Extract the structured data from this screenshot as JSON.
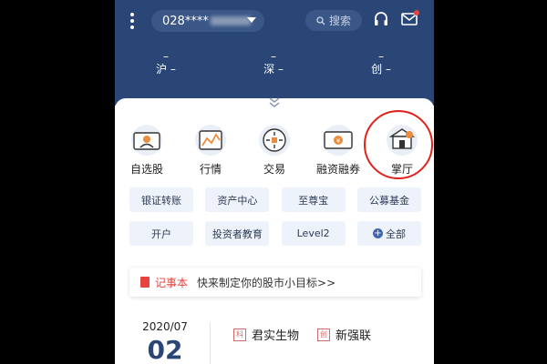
{
  "header": {
    "account": "028****",
    "search_label": "搜索",
    "indices": [
      {
        "name": "沪 –",
        "value": "–"
      },
      {
        "name": "深 –",
        "value": "–"
      },
      {
        "name": "创 –",
        "value": "–"
      }
    ]
  },
  "main_grid": [
    {
      "label": "自选股",
      "icon": "watchlist-icon"
    },
    {
      "label": "行情",
      "icon": "market-icon"
    },
    {
      "label": "交易",
      "icon": "trade-icon"
    },
    {
      "label": "融资融券",
      "icon": "margin-icon"
    },
    {
      "label": "掌厅",
      "icon": "hall-icon"
    }
  ],
  "chips_row1": [
    "银证转账",
    "资产中心",
    "至尊宝",
    "公募基金"
  ],
  "chips_row2": [
    "开户",
    "投资者教育",
    "Level2",
    "全部"
  ],
  "notebook": {
    "tag": "记事本",
    "text": "快来制定你的股市小目标>>"
  },
  "calendar": {
    "year_month": "2020/07",
    "day": "02"
  },
  "stocks": [
    {
      "tag": "科",
      "name": "君实生物"
    },
    {
      "tag": "创",
      "name": "新强联"
    }
  ],
  "colors": {
    "header": "#2a4677",
    "accent_red": "#e0211c",
    "chip_bg": "#eef2fa"
  }
}
